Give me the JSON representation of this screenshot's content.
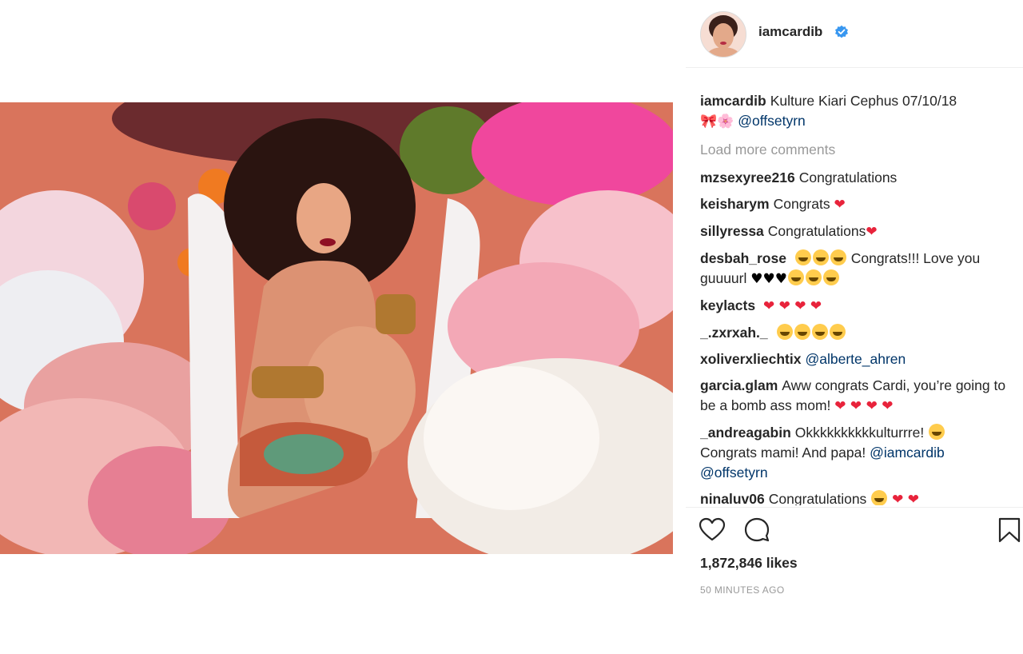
{
  "post": {
    "username": "iamcardib",
    "verified": true,
    "caption": {
      "user": "iamcardib",
      "text": "Kulture Kiari Cephus 07/10/18",
      "emojis": "🎀🌸",
      "mention": "@offsetyrn"
    },
    "load_more": "Load more comments",
    "comments": [
      {
        "user": "mzsexyree216",
        "text": "Congratulations",
        "emoji": ""
      },
      {
        "user": "keisharym",
        "text": "Congrats",
        "emoji": "❤"
      },
      {
        "user": "sillyressa",
        "text": "Congratulations",
        "emoji": "❤"
      },
      {
        "user": "desbah_rose",
        "text": "Congrats!!! Love you guuuurl",
        "emoji": "♥♥♥"
      },
      {
        "user": "keylacts",
        "text": "",
        "emoji": "❤ ❤ ❤ ❤"
      },
      {
        "user": "_.zxrxah._",
        "text": "",
        "emoji": ""
      },
      {
        "user": "xoliverxliechtix",
        "text": "",
        "mention": "@alberte_ahren"
      },
      {
        "user": "garcia.glam",
        "text": "Aww congrats Cardi, you’re going to be a bomb ass mom!",
        "emoji": "❤ ❤ ❤ ❤"
      },
      {
        "user": "_andreagabin",
        "text": "Okkkkkkkkkkulturrre!",
        "text2": "Congrats mami! And papa!",
        "mention": "@iamcardib",
        "mention2": "@offsetyrn"
      },
      {
        "user": "ninaluv06",
        "text": "Congratulations",
        "emoji": "❤ ❤"
      }
    ],
    "likes": "1,872,846 likes",
    "timestamp": "50 MINUTES AGO"
  },
  "colors": {
    "text": "#262626",
    "muted": "#999999",
    "mention": "#003569",
    "verified": "#3897f0",
    "heart": "#e8233b"
  },
  "icons": {
    "like": "heart-outline-icon",
    "comment": "comment-bubble-icon",
    "save": "bookmark-icon",
    "verified": "verified-badge-icon"
  }
}
